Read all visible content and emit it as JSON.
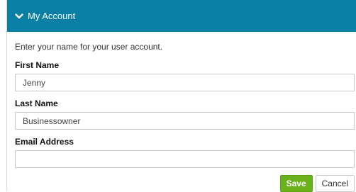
{
  "panel": {
    "title": "My Account",
    "header_color": "#0a7fa5",
    "icon": "chevron-down-icon"
  },
  "form": {
    "intro": "Enter your name for your user account.",
    "first_name": {
      "label": "First Name",
      "value": "Jenny"
    },
    "last_name": {
      "label": "Last Name",
      "value": "Businessowner"
    },
    "email": {
      "label": "Email Address",
      "value": ""
    }
  },
  "actions": {
    "save_label": "Save",
    "cancel_label": "Cancel",
    "save_color": "#6bb21a"
  }
}
